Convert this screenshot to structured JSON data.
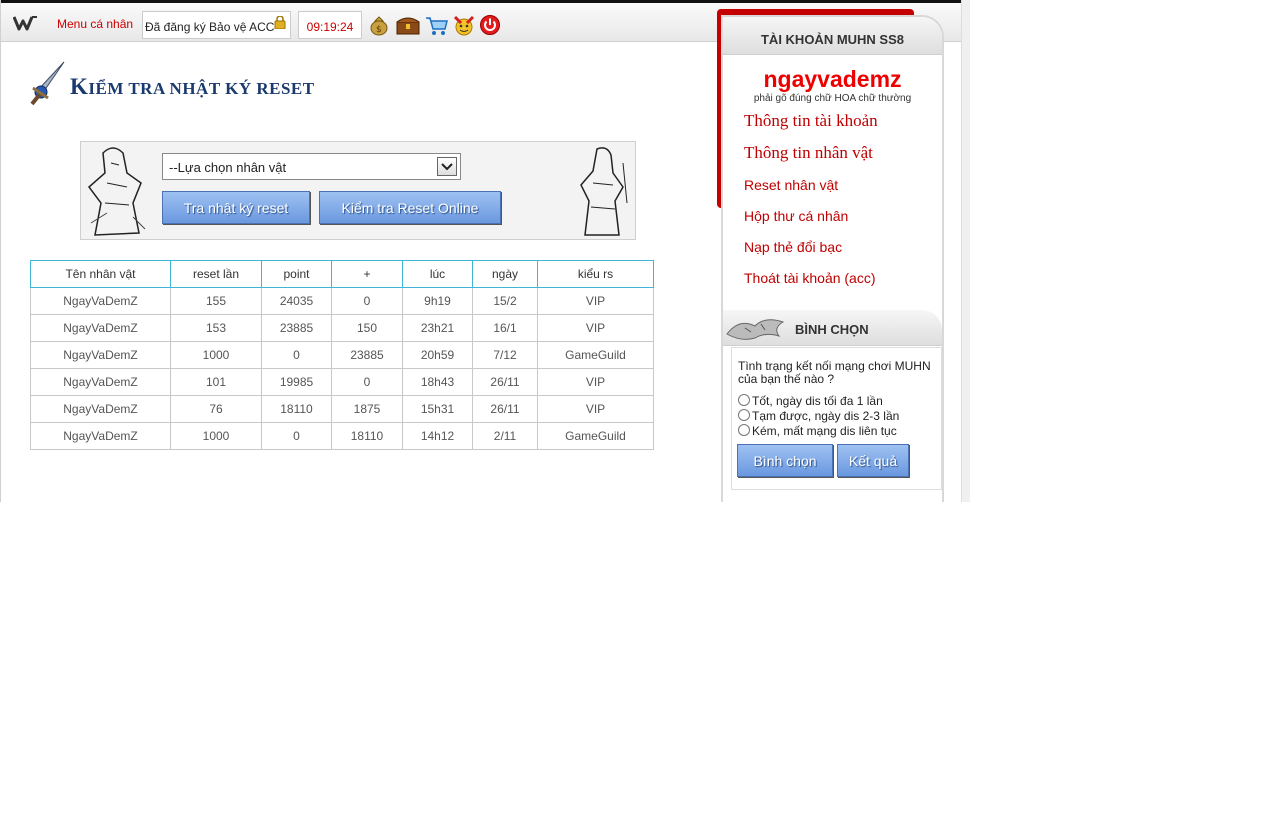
{
  "topbar": {
    "menu_label": "Menu cá nhân",
    "account_status": "Đã đăng ký Bảo vệ ACC",
    "clock": "09:19:24",
    "icons": [
      "money-bag-icon",
      "treasure-chest-icon",
      "shopping-cart-icon",
      "gift-icon",
      "power-icon"
    ]
  },
  "page": {
    "title_first": "K",
    "title_rest": "IỂM TRA NHẬT KÝ RESET"
  },
  "filter": {
    "select_value": "--Lựa chọn nhân vật",
    "btn_log": "Tra nhật ký reset",
    "btn_online": "Kiểm tra Reset Online"
  },
  "table": {
    "headers": [
      "Tên nhân vật",
      "reset lần",
      "point",
      "+",
      "lúc",
      "ngày",
      "kiểu rs"
    ],
    "rows": [
      [
        "NgayVaDemZ",
        "155",
        "24035",
        "0",
        "9h19",
        "15/2",
        "VIP"
      ],
      [
        "NgayVaDemZ",
        "153",
        "23885",
        "150",
        "23h21",
        "16/1",
        "VIP"
      ],
      [
        "NgayVaDemZ",
        "1000",
        "0",
        "23885",
        "20h59",
        "7/12",
        "GameGuild"
      ],
      [
        "NgayVaDemZ",
        "101",
        "19985",
        "0",
        "18h43",
        "26/11",
        "VIP"
      ],
      [
        "NgayVaDemZ",
        "76",
        "18110",
        "1875",
        "15h31",
        "26/11",
        "VIP"
      ],
      [
        "NgayVaDemZ",
        "1000",
        "0",
        "18110",
        "14h12",
        "2/11",
        "GameGuild"
      ]
    ]
  },
  "sidebar": {
    "header": "TÀI KHOẢN MUHN SS8",
    "username": "ngayvademz",
    "note": "phải gõ đúng chữ HOA chữ thường",
    "links_big": [
      "Thông tin tài khoản",
      "Thông tin nhân vật"
    ],
    "links": [
      "Reset nhân vật",
      "Hộp thư cá nhân",
      "Nạp thẻ đổi bạc",
      "Thoát tài khoản (acc)"
    ]
  },
  "poll": {
    "title": "BÌNH CHỌN",
    "question": "Tình trạng kết nối mạng chơi MUHN của bạn thế nào ?",
    "options": [
      "Tốt, ngày dis tối đa 1 lần",
      "Tạm được, ngày dis 2-3 lần",
      "Kém, mất mạng dis liên tục"
    ],
    "btn_vote": "Bình chọn",
    "btn_result": "Kết quả"
  },
  "colors": {
    "accent_red": "#c40000",
    "title_blue": "#1a3a6e",
    "button_blue": "#7ba4e6",
    "table_header_border": "#3fb6d8"
  }
}
